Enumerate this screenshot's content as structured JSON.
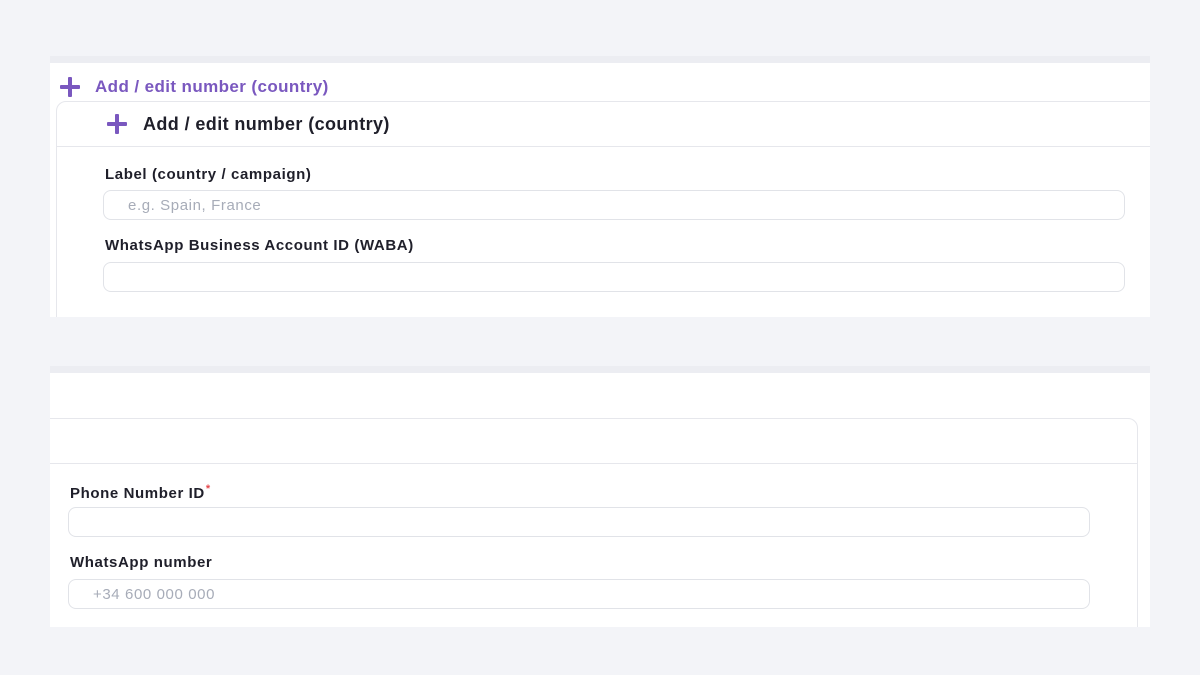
{
  "top": {
    "summary_title": "Add / edit number (country)",
    "card_title": "Add / edit number (country)",
    "label_field": {
      "label": "Label (country / campaign)",
      "placeholder": "e.g. Spain, France",
      "value": ""
    },
    "waba_field": {
      "label": "WhatsApp Business Account ID (WABA)",
      "placeholder": "",
      "value": ""
    }
  },
  "bottom": {
    "phone_id_field": {
      "label": "Phone Number ID",
      "required_mark": "*",
      "placeholder": "",
      "value": ""
    },
    "whatsapp_number_field": {
      "label": "WhatsApp number",
      "placeholder": "+34 600 000 000",
      "value": ""
    }
  },
  "colors": {
    "accent": "#7a58bf",
    "required": "#e5484d",
    "background": "#f3f4f8"
  },
  "icons": {
    "summary_icon": "plus-icon",
    "card_icon": "plus-icon"
  }
}
